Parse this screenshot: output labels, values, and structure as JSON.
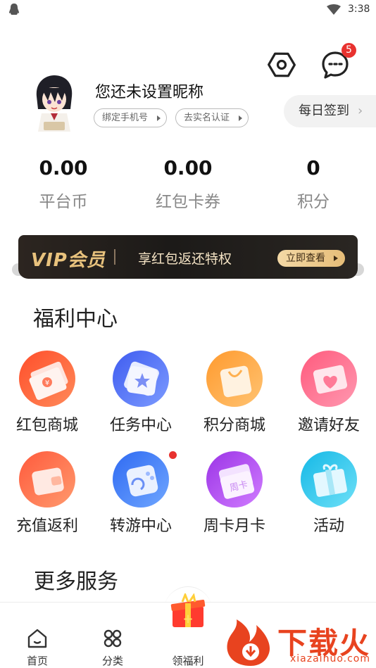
{
  "status_bar": {
    "time": "3:38"
  },
  "header": {
    "message_badge_count": "5"
  },
  "profile": {
    "nickname": "您还未设置昵称",
    "bind_phone_label": "绑定手机号",
    "real_name_label": "去实名认证",
    "checkin_label": "每日签到",
    "checkin_chevron": "›"
  },
  "stats": [
    {
      "value": "0.00",
      "label": "平台币"
    },
    {
      "value": "0.00",
      "label": "红包卡券"
    },
    {
      "value": "0",
      "label": "积分"
    }
  ],
  "vip": {
    "title": "VIP会员",
    "description": "享红包返还特权",
    "button_label": "立即查看"
  },
  "welfare": {
    "title": "福利中心",
    "items": [
      {
        "label": "红包商城",
        "icon": "red-envelope-icon",
        "color": "#ff5a36"
      },
      {
        "label": "任务中心",
        "icon": "task-icon",
        "color": "#4c6ef5"
      },
      {
        "label": "积分商城",
        "icon": "shopping-bag-icon",
        "color": "#ffa43b"
      },
      {
        "label": "邀请好友",
        "icon": "invite-heart-icon",
        "color": "#ff6b8a"
      },
      {
        "label": "充值返利",
        "icon": "wallet-icon",
        "color": "#ff6a4d"
      },
      {
        "label": "转游中心",
        "icon": "gamepad-icon",
        "color": "#3d7ff5"
      },
      {
        "label": "周卡月卡",
        "icon": "weekly-card-icon",
        "color": "#b046e8"
      },
      {
        "label": "活动",
        "icon": "gift-box-icon",
        "color": "#23c3e6"
      }
    ]
  },
  "services": {
    "title": "更多服务"
  },
  "bottom_nav": {
    "items": [
      {
        "label": "首页",
        "icon": "home-icon"
      },
      {
        "label": "分类",
        "icon": "category-grid-icon"
      },
      {
        "label": "领福利",
        "icon": "gift-icon"
      }
    ]
  },
  "watermark": {
    "text": "下载火",
    "url": "xiazaihuo.com"
  }
}
